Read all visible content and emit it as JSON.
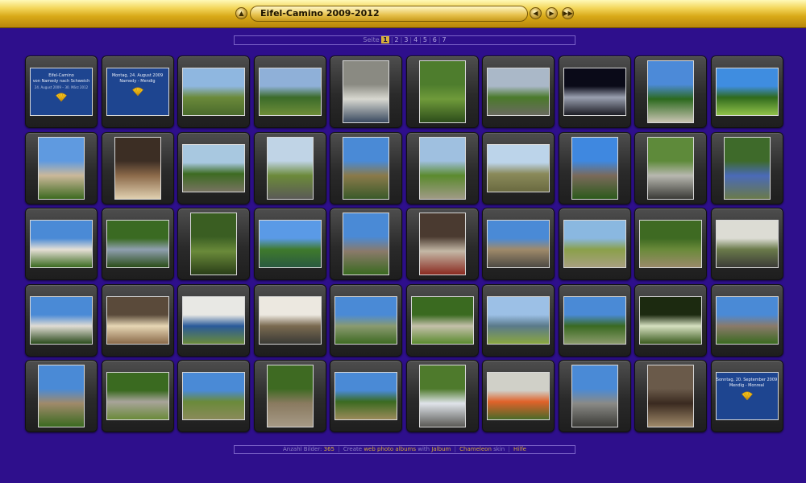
{
  "header": {
    "title": "Eifel-Camino 2009-2012",
    "icons": [
      "up-icon",
      "prev-icon",
      "play-icon",
      "next-icon"
    ]
  },
  "pager": {
    "label": "Seite",
    "pages": [
      "1",
      "2",
      "3",
      "4",
      "5",
      "6",
      "7"
    ],
    "current": "1"
  },
  "gallery": {
    "thumbs": [
      {
        "kind": "card",
        "line1": "Eifel-Camino",
        "line2": "von Namedy nach Schweich",
        "line3": "24. August 2009 – 30. März 2012"
      },
      {
        "kind": "card",
        "line1": "Montag, 24. August 2009",
        "line2": "Namedy - Mendig",
        "line3": ""
      },
      {
        "kind": "land",
        "colors": [
          "#8fb7e0",
          "#6b8a3a",
          "#4a6a2c"
        ]
      },
      {
        "kind": "land",
        "colors": [
          "#8fb0d8",
          "#3b6b2a",
          "#6e8d38"
        ]
      },
      {
        "kind": "port",
        "colors": [
          "#8a8a82",
          "#d8d8d0",
          "#3a4a60"
        ]
      },
      {
        "kind": "port",
        "colors": [
          "#4e7d2d",
          "#6f9a3a",
          "#2c4c1a"
        ]
      },
      {
        "kind": "land",
        "colors": [
          "#aab8c8",
          "#4a7a2a",
          "#6a6a60"
        ]
      },
      {
        "kind": "land",
        "colors": [
          "#0a0a18",
          "#9aa0b0",
          "#1c1c24"
        ]
      },
      {
        "kind": "port",
        "colors": [
          "#4c8ad8",
          "#2c6a1e",
          "#c9c4b2"
        ]
      },
      {
        "kind": "land",
        "colors": [
          "#3f8de0",
          "#2f6a1c",
          "#91c24a"
        ]
      },
      {
        "kind": "port",
        "colors": [
          "#5f9ae0",
          "#cbb89a",
          "#3d6a20"
        ]
      },
      {
        "kind": "port",
        "colors": [
          "#3c2e24",
          "#8c6a4a",
          "#e0d0b0"
        ]
      },
      {
        "kind": "land",
        "colors": [
          "#a8c8e0",
          "#3d6b22",
          "#777360"
        ]
      },
      {
        "kind": "port",
        "colors": [
          "#c0d4e6",
          "#6c8a3a",
          "#5a5a56"
        ]
      },
      {
        "kind": "port",
        "colors": [
          "#4a8ad6",
          "#8a7a4a",
          "#3a5a2a"
        ]
      },
      {
        "kind": "port",
        "colors": [
          "#9fc0e0",
          "#5b8a2e",
          "#a09a86"
        ]
      },
      {
        "kind": "land",
        "colors": [
          "#bcd4ea",
          "#8a8a5a",
          "#6a6a40"
        ]
      },
      {
        "kind": "port",
        "colors": [
          "#3f88e0",
          "#7a6a5a",
          "#2c5a1c"
        ]
      },
      {
        "kind": "port",
        "colors": [
          "#5e8a3a",
          "#b8b8b0",
          "#3a3a36"
        ]
      },
      {
        "kind": "port",
        "colors": [
          "#3e6a2a",
          "#4a6ab8",
          "#6a7a4a"
        ]
      },
      {
        "kind": "land",
        "colors": [
          "#4a8ad6",
          "#e6e0d6",
          "#3a6a20"
        ]
      },
      {
        "kind": "land",
        "colors": [
          "#3a6a22",
          "#90a0b0",
          "#2a4c18"
        ]
      },
      {
        "kind": "port",
        "colors": [
          "#3a5e22",
          "#6a8a3a",
          "#2a3e18"
        ]
      },
      {
        "kind": "land",
        "colors": [
          "#5a9ae6",
          "#3f7a2c",
          "#2a5a40"
        ]
      },
      {
        "kind": "port",
        "colors": [
          "#4a8ad6",
          "#8a7a6a",
          "#3a6a20"
        ]
      },
      {
        "kind": "port",
        "colors": [
          "#4a3a30",
          "#c4b8a6",
          "#8a2a20"
        ]
      },
      {
        "kind": "land",
        "colors": [
          "#4a8ad6",
          "#a08a6a",
          "#4c4a44"
        ]
      },
      {
        "kind": "land",
        "colors": [
          "#8ab8e0",
          "#8aa04a",
          "#a8a080"
        ]
      },
      {
        "kind": "land",
        "colors": [
          "#3e6a22",
          "#6a8a3a",
          "#9a8a6a"
        ]
      },
      {
        "kind": "land",
        "colors": [
          "#dcdcd4",
          "#6a7a4a",
          "#3c3c38"
        ]
      },
      {
        "kind": "land",
        "colors": [
          "#4a8ad6",
          "#e0dcd4",
          "#2a4a1c"
        ]
      },
      {
        "kind": "land",
        "colors": [
          "#5a4a3a",
          "#e6d6b4",
          "#8a6a4a"
        ]
      },
      {
        "kind": "land",
        "colors": [
          "#e8e8e4",
          "#2a5a9a",
          "#6a8a3a"
        ]
      },
      {
        "kind": "land",
        "colors": [
          "#ece8e0",
          "#7a6a50",
          "#3a3a36"
        ]
      },
      {
        "kind": "land",
        "colors": [
          "#4a8ad6",
          "#8a9a70",
          "#3e6a22"
        ]
      },
      {
        "kind": "land",
        "colors": [
          "#3a6a20",
          "#c4c0aa",
          "#5a8a2e"
        ]
      },
      {
        "kind": "land",
        "colors": [
          "#9cc0e6",
          "#5a7a8a",
          "#8aa640"
        ]
      },
      {
        "kind": "land",
        "colors": [
          "#4a8ad6",
          "#3a6a22",
          "#8a9a6a"
        ]
      },
      {
        "kind": "land",
        "colors": [
          "#1c2a10",
          "#d6e0c0",
          "#3a5a1e"
        ]
      },
      {
        "kind": "land",
        "colors": [
          "#4a8ad6",
          "#8a7a6a",
          "#3a6a20"
        ]
      },
      {
        "kind": "port",
        "colors": [
          "#4a8ad6",
          "#a08a6a",
          "#3a6a20"
        ]
      },
      {
        "kind": "land",
        "colors": [
          "#3a6a20",
          "#a8a49a",
          "#6a8a3a"
        ]
      },
      {
        "kind": "land",
        "colors": [
          "#4a8ad6",
          "#6a8a3a",
          "#8a8a5a"
        ]
      },
      {
        "kind": "port",
        "colors": [
          "#3e6a22",
          "#8a7a60",
          "#a69a86"
        ]
      },
      {
        "kind": "land",
        "colors": [
          "#4a8ad6",
          "#3a6a20",
          "#9a8a5a"
        ]
      },
      {
        "kind": "port",
        "colors": [
          "#4e7a2c",
          "#e0e4ea",
          "#5a5a56"
        ]
      },
      {
        "kind": "land",
        "colors": [
          "#d0d0c8",
          "#e0622a",
          "#4a6a2a"
        ]
      },
      {
        "kind": "port",
        "colors": [
          "#4a8ad6",
          "#8a8a86",
          "#3a3a36"
        ]
      },
      {
        "kind": "port",
        "colors": [
          "#6a5a4a",
          "#3a2a20",
          "#a08a6a"
        ]
      },
      {
        "kind": "card",
        "line1": "Sonntag, 20. September 2009",
        "line2": "Mendig - Monreal",
        "line3": ""
      }
    ]
  },
  "footer": {
    "count_label": "Anzahl Bilder:",
    "count_value": "365",
    "create": "Create",
    "web_albums": "web photo albums",
    "with": "with",
    "jalbum": "Jalbum",
    "chameleon": "Chameleon",
    "skin": "skin",
    "help": "Hilfe"
  },
  "colors": {
    "background": "#2e0f8c",
    "gold": "#d8a918",
    "card_blue": "#1e4590",
    "link": "#d3a83a"
  }
}
